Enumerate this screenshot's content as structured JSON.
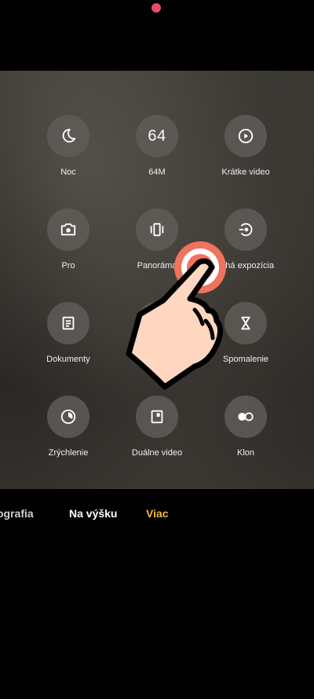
{
  "modes": [
    {
      "label": "Noc",
      "icon": "moon-icon"
    },
    {
      "label": "64M",
      "icon_text": "64"
    },
    {
      "label": "Krátke video",
      "icon": "play-circle-icon"
    },
    {
      "label": "Pro",
      "icon": "camera-icon"
    },
    {
      "label": "Panoráma",
      "icon": "panorama-icon"
    },
    {
      "label": "Dlhá expozícia",
      "icon": "long-exposure-icon"
    },
    {
      "label": "Dokumenty",
      "icon": "document-icon"
    },
    {
      "label": "",
      "icon": "hidden-under-hand"
    },
    {
      "label": "Spomalenie",
      "icon": "hourglass-icon"
    },
    {
      "label": "Zrýchlenie",
      "icon": "timelapse-icon"
    },
    {
      "label": "Duálne video",
      "icon": "dual-video-icon"
    },
    {
      "label": "Klon",
      "icon": "clone-icon"
    }
  ],
  "tabs": {
    "partial": "ografia",
    "portrait": "Na výšku",
    "more": "Viac"
  },
  "colors": {
    "active_tab": "#f3b63a",
    "tap_indicator": "#f0735d",
    "notch_dot": "#e84a6d"
  }
}
